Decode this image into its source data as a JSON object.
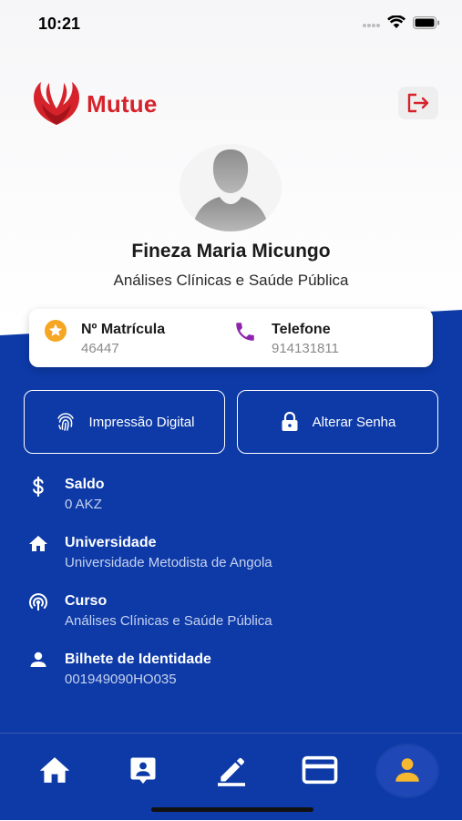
{
  "status_bar": {
    "time": "10:21"
  },
  "header": {
    "brand": "Mutue"
  },
  "profile": {
    "name": "Fineza Maria Micungo",
    "course": "Análises Clínicas e Saúde Pública"
  },
  "info_card": {
    "matricula_label": "Nº Matrícula",
    "matricula_value": "46447",
    "telefone_label": "Telefone",
    "telefone_value": "914131811"
  },
  "actions": {
    "fingerprint_label": "Impressão Digital",
    "password_label": "Alterar Senha"
  },
  "details": [
    {
      "title": "Saldo",
      "value": "0 AKZ",
      "icon": "dollar-icon"
    },
    {
      "title": "Universidade",
      "value": "Universidade Metodista de Angola",
      "icon": "home-icon"
    },
    {
      "title": "Curso",
      "value": "Análises Clínicas e Saúde Pública",
      "icon": "broadcast-icon"
    },
    {
      "title": "Bilhete de Identidade",
      "value": "001949090HO035",
      "icon": "person-icon"
    }
  ],
  "nav": {
    "items": [
      "home-icon",
      "contact-card-icon",
      "edit-icon",
      "credit-card-icon",
      "profile-icon"
    ],
    "active": "profile-icon"
  },
  "colors": {
    "primary_blue": "#0d3aa7",
    "brand_red": "#d6232b",
    "star_orange": "#f5a623",
    "phone_purple": "#8e24aa",
    "active_profile": "#f5b82e"
  }
}
